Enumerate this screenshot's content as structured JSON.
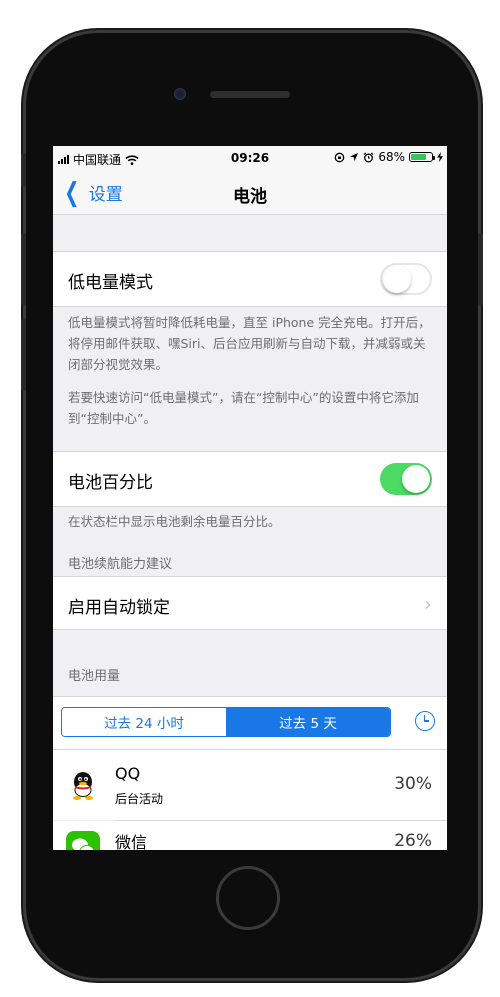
{
  "status_bar": {
    "carrier": "中国联通",
    "time": "09:26",
    "battery_percent": "68%"
  },
  "nav": {
    "back_label": "设置",
    "title": "电池"
  },
  "low_power": {
    "label": "低电量模式",
    "enabled": false,
    "note_1": "低电量模式将暂时降低耗电量，直至 iPhone 完全充电。打开后，将停用邮件获取、嘿Siri、后台应用刷新与自动下载，并减弱或关闭部分视觉效果。",
    "note_2": "若要快速访问“低电量模式”，请在“控制中心”的设置中将它添加到“控制中心”。"
  },
  "battery_percentage": {
    "label": "电池百分比",
    "enabled": true,
    "note": "在状态栏中显示电池剩余电量百分比。"
  },
  "suggestions": {
    "header": "电池续航能力建议",
    "item": "启用自动锁定"
  },
  "usage": {
    "header": "电池用量",
    "segments": [
      "过去 24 小时",
      "过去 5 天"
    ],
    "selected_segment": 1,
    "apps": [
      {
        "name": "QQ",
        "sub": "后台活动",
        "percent": "30%"
      },
      {
        "name": "微信",
        "sub": "",
        "percent": "26%"
      }
    ]
  },
  "colors": {
    "accent": "#1a78e6",
    "toggle_on": "#4cd964"
  }
}
